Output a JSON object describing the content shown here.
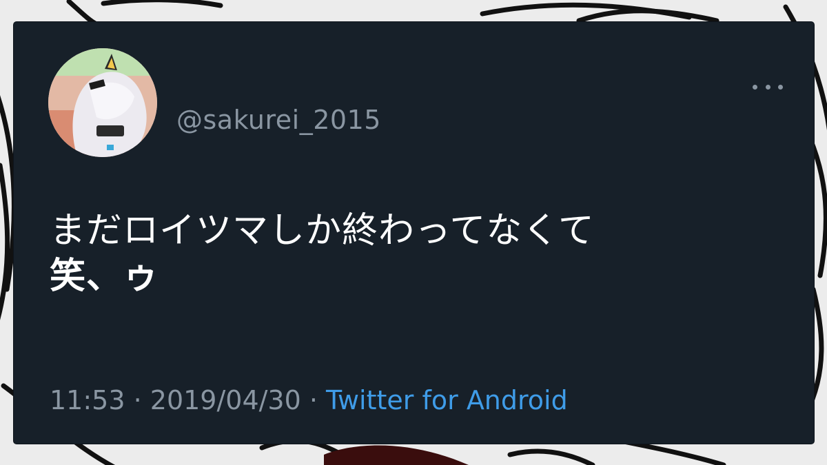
{
  "tweet": {
    "handle": "@sakurei_2015",
    "text_line1": "まだロイツマしか終わってなくて",
    "text_line2": "笑、ゥ",
    "time": "11:53",
    "separator": " · ",
    "date": "2019/04/30",
    "source": "Twitter for Android"
  },
  "icons": {
    "more": "more-options-icon",
    "avatar": "profile-avatar-image"
  },
  "colors": {
    "card_background": "#172029",
    "text_primary": "#ffffff",
    "text_secondary": "#8a96a2",
    "link": "#3f9ce8"
  }
}
